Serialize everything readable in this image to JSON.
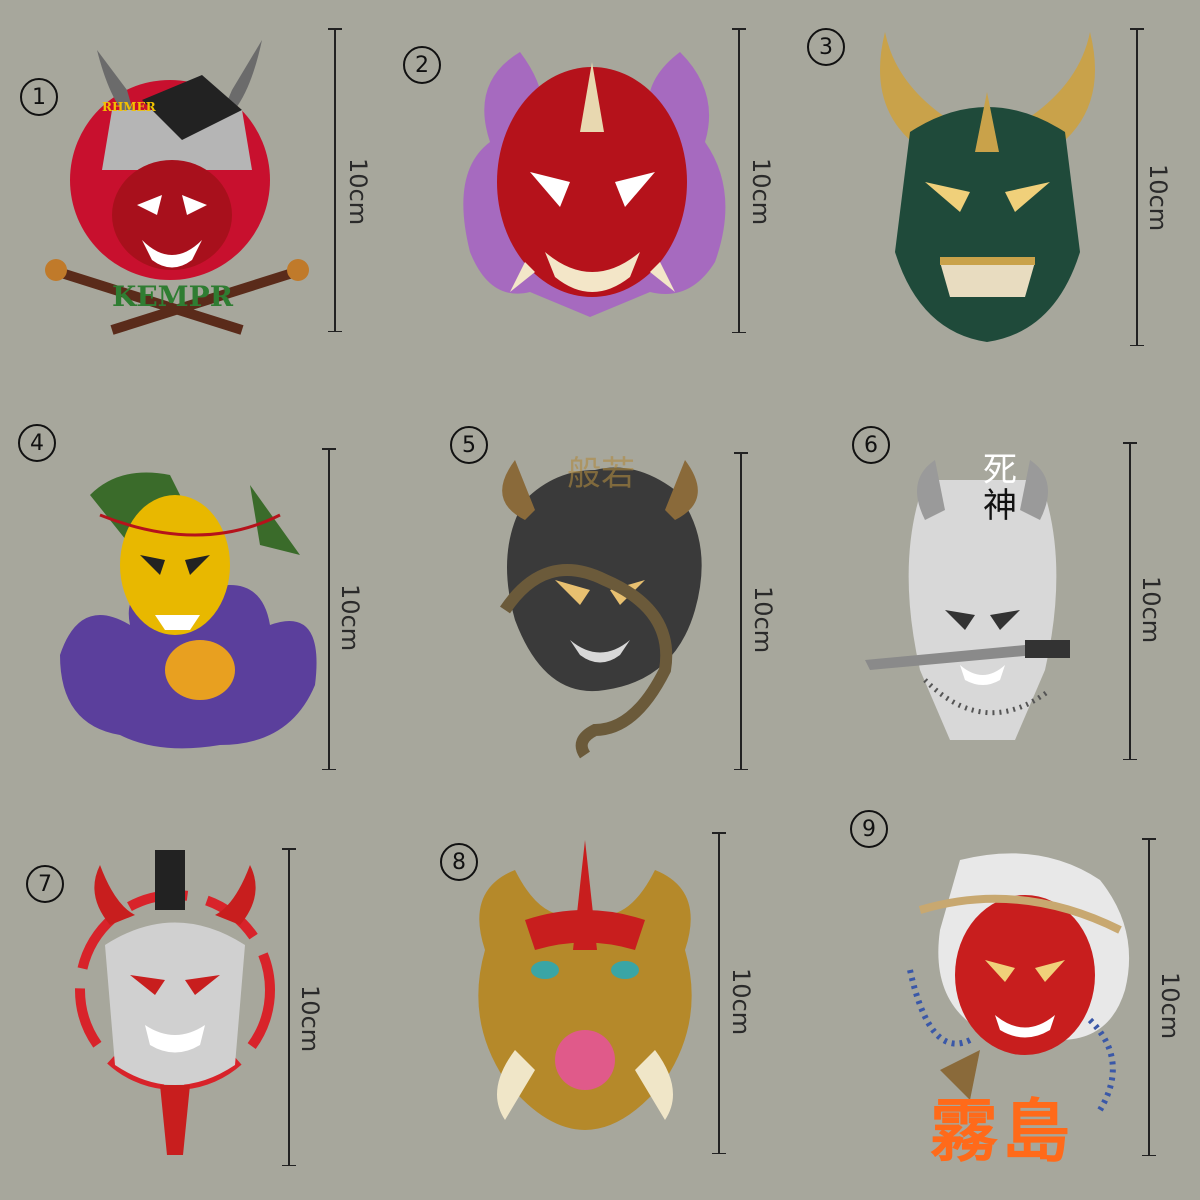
{
  "items": [
    {
      "number": "1",
      "size_label": "10cm",
      "text": "RHMER",
      "text2": "KEMPR",
      "colors": {
        "accent": "#c8102e"
      }
    },
    {
      "number": "2",
      "size_label": "10cm",
      "colors": {
        "accent": "#b5121b"
      }
    },
    {
      "number": "3",
      "size_label": "10cm",
      "colors": {
        "accent": "#1f4a3a"
      }
    },
    {
      "number": "4",
      "size_label": "10cm",
      "colors": {
        "accent": "#e8b800"
      }
    },
    {
      "number": "5",
      "size_label": "10cm",
      "text": "般若",
      "colors": {
        "accent": "#3a3a3a"
      }
    },
    {
      "number": "6",
      "size_label": "10cm",
      "text": "死",
      "text2": "神",
      "colors": {
        "accent": "#d8d8d8"
      }
    },
    {
      "number": "7",
      "size_label": "10cm",
      "colors": {
        "accent": "#d8232a"
      }
    },
    {
      "number": "8",
      "size_label": "10cm",
      "colors": {
        "accent": "#b5892a"
      }
    },
    {
      "number": "9",
      "size_label": "10cm",
      "text": "霧島",
      "colors": {
        "accent": "#c81e1e"
      }
    }
  ]
}
